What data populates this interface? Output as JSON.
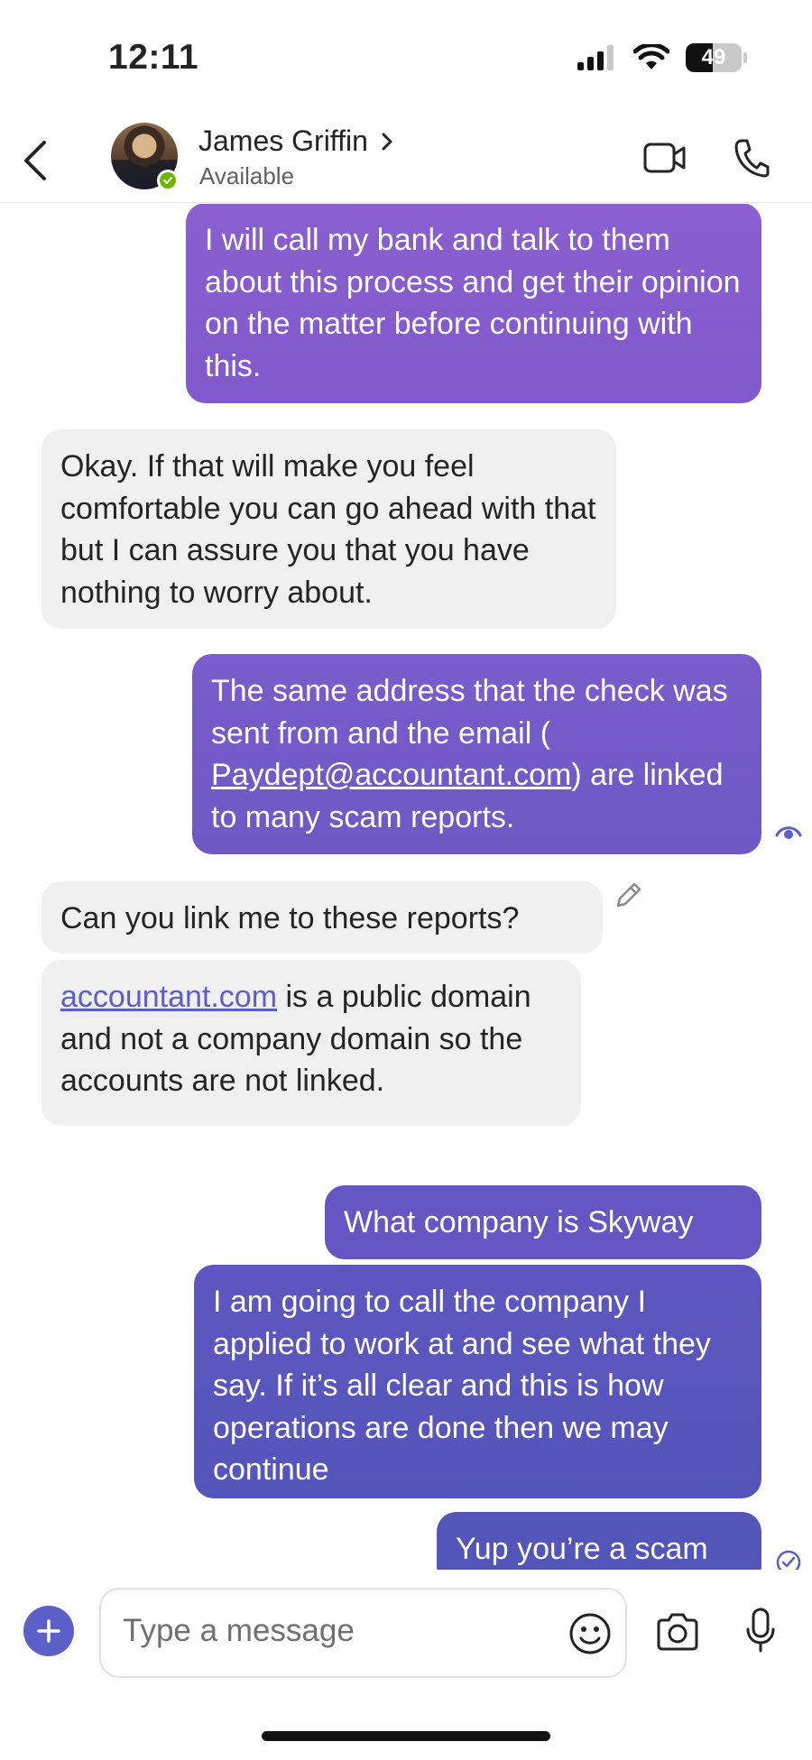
{
  "status_bar": {
    "time": "12:11",
    "battery_text": "49",
    "battery_level": 0.49,
    "icons": [
      "signal-icon",
      "wifi-icon",
      "battery-icon"
    ]
  },
  "header": {
    "contact_name": "James Griffin",
    "contact_status": "Available",
    "presence": "available",
    "icons": [
      "back-icon",
      "chevron-right-icon",
      "video-call-icon",
      "phone-call-icon"
    ]
  },
  "messages": [
    {
      "direction": "outgoing",
      "text": "I will call my bank and talk to them about this process and get their opinion on the matter before continuing with this."
    },
    {
      "direction": "incoming",
      "text": "Okay. If that will make you feel comfortable you can go ahead with that but I can assure you that you have nothing to worry about."
    },
    {
      "direction": "outgoing",
      "parts": [
        "The same address that the check was sent from and the email ( ",
        "Paydept@accountant.com",
        ") are linked to many scam reports."
      ],
      "status": "seen"
    },
    {
      "direction": "incoming",
      "text": "Can you link me to these reports?",
      "edited": true
    },
    {
      "direction": "incoming",
      "parts": [
        "accountant.com",
        " is a public domain and not a company domain so the accounts are not linked."
      ]
    },
    {
      "direction": "outgoing",
      "text": "What company is Skyway"
    },
    {
      "direction": "outgoing",
      "text": "I am going to call the company I applied to work at and see what they say. If it’s all clear and this is how operations are done then we may continue"
    },
    {
      "direction": "outgoing",
      "text": "Yup you’re a scam",
      "status": "sent"
    }
  ],
  "compose": {
    "placeholder": "Type a message",
    "icons": [
      "add-icon",
      "emoji-icon",
      "camera-icon",
      "microphone-icon"
    ]
  },
  "colors": {
    "bubble_out_top": "#8a5fd0",
    "bubble_out_bottom": "#5255b8",
    "bubble_in": "#f0f0f0",
    "accent": "#5b5fc7",
    "presence_available": "#6bb700"
  }
}
